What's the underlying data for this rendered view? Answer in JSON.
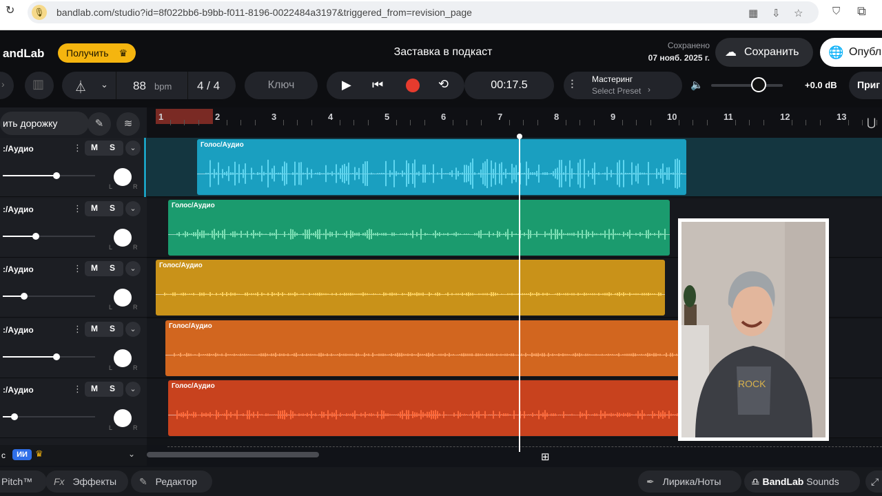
{
  "browser": {
    "url": "bandlab.com/studio?id=8f022bb6-b9bb-f011-8196-0022484a3197&triggered_from=revision_page"
  },
  "header": {
    "logo": "andLab",
    "get_label": "Получить",
    "project_title": "Заставка в подкаст",
    "saved_label": "Сохранено",
    "saved_date": "07 нояб. 2025 г.",
    "save_label": "Сохранить",
    "publish_label": "Опубл"
  },
  "transport": {
    "bpm": "88",
    "bpm_unit": "bpm",
    "time_signature": "4 / 4",
    "key_label": "Ключ",
    "time": "00:17.5",
    "mastering_label": "Мастеринг",
    "mastering_preset": "Select Preset",
    "volume_level": 0.6,
    "db": "+0.0 dB",
    "invite_label": "Приг"
  },
  "track_panel": {
    "add_track_label": "ить дорожку",
    "tracks": [
      {
        "name": ":/Аудио",
        "m": "M",
        "s": "S",
        "volume": 0.58
      },
      {
        "name": ":/Аудио",
        "m": "M",
        "s": "S",
        "volume": 0.36
      },
      {
        "name": ":/Аудио",
        "m": "M",
        "s": "S",
        "volume": 0.23
      },
      {
        "name": ":/Аудио",
        "m": "M",
        "s": "S",
        "volume": 0.58
      },
      {
        "name": ":/Аудио",
        "m": "M",
        "s": "S",
        "volume": 0.13
      }
    ],
    "pan": {
      "left": "L",
      "right": "R"
    },
    "master": {
      "label": "с",
      "ai_badge": "ИИ"
    }
  },
  "timeline": {
    "bar_numbers": [
      "1",
      "2",
      "3",
      "4",
      "5",
      "6",
      "7",
      "8",
      "9",
      "10",
      "11",
      "12",
      "13"
    ],
    "clips": [
      {
        "label": "Голос/Аудио",
        "color": "#1a9fc0"
      },
      {
        "label": "Голос/Аудио",
        "color": "#1b9b6e"
      },
      {
        "label": "Голос/Аудио",
        "color": "#c99219"
      },
      {
        "label": "Голос/Аудио",
        "color": "#d2661f"
      },
      {
        "label": "Голос/Аудио",
        "color": "#c8421e"
      }
    ]
  },
  "bottom": {
    "pitch": "Pitch™",
    "effects": "Эффекты",
    "editor": "Редактор",
    "lyrics": "Лирика/Ноты",
    "sounds_brand": "BandLab",
    "sounds": "Sounds"
  }
}
